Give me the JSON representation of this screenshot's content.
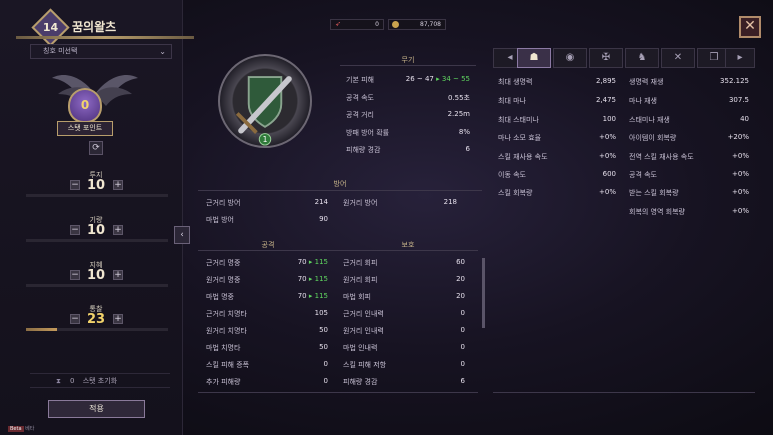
{
  "character": {
    "level": "14",
    "name": "꿈의왈츠",
    "title_select": "칭호 미선택"
  },
  "stat_points": {
    "value": "0",
    "label": "스탯 포인트"
  },
  "stats": [
    {
      "name": "투지",
      "value": "10",
      "bar": 0.0
    },
    {
      "name": "기량",
      "value": "10",
      "bar": 0.0
    },
    {
      "name": "지혜",
      "value": "10",
      "bar": 0.0
    },
    {
      "name": "통찰",
      "value": "23",
      "bar": 0.22
    }
  ],
  "reset": {
    "count": "0",
    "label": "스탯 초기화"
  },
  "apply_label": "적용",
  "beta_label": "Beta",
  "beta_text": "베타",
  "currency": {
    "a": "0",
    "b": "87,708"
  },
  "icons": {
    "close": "close-icon",
    "refresh": "refresh-icon",
    "collapse": "chevron-left-icon"
  },
  "weapon": {
    "heading": "무기",
    "badge": "1",
    "rows": [
      {
        "label": "기본 피해",
        "from": "26 ~ 47",
        "arrow": "▸",
        "to": "34 ~ 55"
      },
      {
        "label": "공격 속도",
        "value": "0.55초"
      },
      {
        "label": "공격 거리",
        "value": "2.25m"
      },
      {
        "label": "방패 방어 확률",
        "value": "8%"
      },
      {
        "label": "피해량 경감",
        "value": "6"
      }
    ]
  },
  "defense": {
    "heading": "방어",
    "rows": [
      {
        "label": "근거리 방어",
        "value": "214"
      },
      {
        "label": "원거리 방어",
        "value": "218"
      },
      {
        "label": "마법 방어",
        "value": "90"
      }
    ]
  },
  "attack": {
    "heading": "공격",
    "rows": [
      {
        "label": "근거리 명중",
        "from": "70",
        "arrow": "▸",
        "to": "115"
      },
      {
        "label": "원거리 명중",
        "from": "70",
        "arrow": "▸",
        "to": "115"
      },
      {
        "label": "마법 명중",
        "from": "70",
        "arrow": "▸",
        "to": "115"
      },
      {
        "label": "근거리 치명타",
        "value": "105"
      },
      {
        "label": "원거리 치명타",
        "value": "50"
      },
      {
        "label": "마법 치명타",
        "value": "50"
      },
      {
        "label": "스킬 피해 증폭",
        "value": "0"
      },
      {
        "label": "추가 피해량",
        "value": "0"
      }
    ]
  },
  "protect": {
    "heading": "보호",
    "rows": [
      {
        "label": "근거리 회피",
        "value": "60"
      },
      {
        "label": "원거리 회피",
        "value": "20"
      },
      {
        "label": "마법 회피",
        "value": "20"
      },
      {
        "label": "근거리 인내력",
        "value": "0"
      },
      {
        "label": "원거리 인내력",
        "value": "0"
      },
      {
        "label": "마법 인내력",
        "value": "0"
      },
      {
        "label": "스킬 피해 저항",
        "value": "0"
      },
      {
        "label": "피해량 경감",
        "value": "6"
      }
    ]
  },
  "right": {
    "col1": [
      {
        "label": "최대 생명력",
        "value": "2,895"
      },
      {
        "label": "최대 마나",
        "value": "2,475"
      },
      {
        "label": "최대 스태미나",
        "value": "100"
      },
      {
        "label": "마나 소모 효율",
        "value": "+0%"
      },
      {
        "label": "스킬 재사용 속도",
        "value": "+0%"
      },
      {
        "label": "이동 속도",
        "value": "600"
      },
      {
        "label": "스킬 회복량",
        "value": "+0%"
      }
    ],
    "col2": [
      {
        "label": "생명력 재생",
        "value": "352.125"
      },
      {
        "label": "마나 재생",
        "value": "307.5"
      },
      {
        "label": "스태미나 재생",
        "value": "40"
      },
      {
        "label": "아이템이 회복량",
        "value": "+20%"
      },
      {
        "label": "전역 스킬 재사용 속도",
        "value": "+0%"
      },
      {
        "label": "공격 속도",
        "value": "+0%"
      },
      {
        "label": "받는 스킬 회복량",
        "value": "+0%"
      },
      {
        "label": "회복의 영역 회복량",
        "value": "+0%"
      }
    ]
  }
}
